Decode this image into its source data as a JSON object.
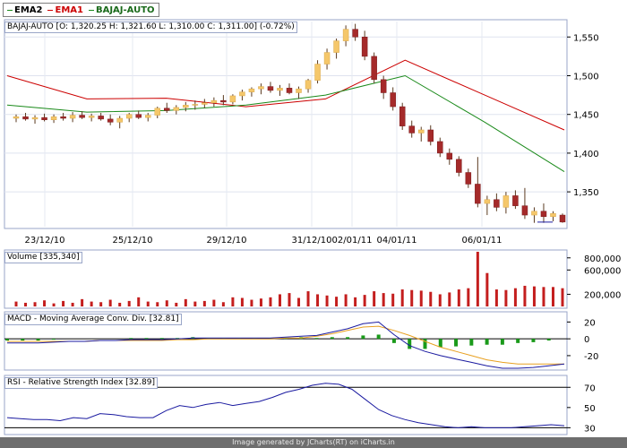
{
  "legend": [
    {
      "name": "EMA2",
      "color": "#1a8a1a"
    },
    {
      "name": "EMA1",
      "color": "#cc0000"
    },
    {
      "name": "BAJAJ-AUTO",
      "color": "#1a8a1a"
    }
  ],
  "price_label": "BAJAJ-AUTO [O: 1,320.25  H: 1,321.60  L: 1,310.00  C: 1,311.00] (-0.72%)",
  "volume_label": "Volume [335,340]",
  "macd_label": "MACD - Moving Average Conv. Div. [32.81]",
  "rsi_label": "RSI - Relative Strength Index [32.89]",
  "footer": "Image generated by JCharts(RT) on iCharts.in",
  "colors": {
    "up": "#f5c76a",
    "down": "#a52a2a",
    "ema1": "#cc0000",
    "ema2": "#1a8a1a",
    "volume": "#c41e1e",
    "macd": "#1a1aa0",
    "signal": "#e8a020",
    "hist_pos": "#1a9a1a",
    "hist_neg": "#1a9a1a",
    "rsi": "#1a1aa0"
  },
  "chart_data": [
    {
      "type": "candlestick",
      "title": "BAJAJ-AUTO",
      "x_tick_labels": [
        "23/12/10",
        "25/12/10",
        "29/12/10",
        "31/12/10",
        "02/01/11",
        "04/01/11",
        "06/01/11"
      ],
      "y_ticks": [
        1350,
        1400,
        1450,
        1500,
        1550
      ],
      "y_tick_labels": [
        "1,350",
        "1,400",
        "1,450",
        "1,500",
        "1,550"
      ],
      "ylim": [
        1305,
        1570
      ],
      "series": [
        {
          "name": "EMA1",
          "values": [
            1500,
            1470,
            1471,
            1460,
            1470,
            1520,
            1475,
            1430
          ]
        },
        {
          "name": "EMA2",
          "values": [
            1462,
            1453,
            1455,
            1462,
            1475,
            1500,
            1440,
            1376
          ]
        }
      ],
      "candles": [
        [
          1445,
          1450,
          1440,
          1447
        ],
        [
          1447,
          1452,
          1442,
          1444
        ],
        [
          1444,
          1449,
          1438,
          1446
        ],
        [
          1446,
          1451,
          1441,
          1443
        ],
        [
          1443,
          1450,
          1439,
          1447
        ],
        [
          1447,
          1452,
          1442,
          1445
        ],
        [
          1445,
          1453,
          1440,
          1449
        ],
        [
          1449,
          1454,
          1444,
          1446
        ],
        [
          1446,
          1451,
          1441,
          1448
        ],
        [
          1448,
          1452,
          1442,
          1444
        ],
        [
          1444,
          1450,
          1436,
          1440
        ],
        [
          1440,
          1448,
          1432,
          1445
        ],
        [
          1445,
          1452,
          1440,
          1450
        ],
        [
          1450,
          1455,
          1444,
          1446
        ],
        [
          1446,
          1452,
          1441,
          1449
        ],
        [
          1449,
          1460,
          1445,
          1458
        ],
        [
          1458,
          1465,
          1452,
          1455
        ],
        [
          1455,
          1462,
          1450,
          1459
        ],
        [
          1459,
          1466,
          1454,
          1462
        ],
        [
          1462,
          1468,
          1456,
          1463
        ],
        [
          1463,
          1470,
          1458,
          1465
        ],
        [
          1465,
          1472,
          1460,
          1468
        ],
        [
          1468,
          1475,
          1462,
          1466
        ],
        [
          1466,
          1476,
          1463,
          1474
        ],
        [
          1474,
          1482,
          1468,
          1479
        ],
        [
          1479,
          1485,
          1473,
          1483
        ],
        [
          1483,
          1490,
          1476,
          1486
        ],
        [
          1486,
          1492,
          1478,
          1481
        ],
        [
          1481,
          1488,
          1474,
          1484
        ],
        [
          1484,
          1490,
          1476,
          1478
        ],
        [
          1478,
          1486,
          1470,
          1483
        ],
        [
          1483,
          1496,
          1478,
          1494
        ],
        [
          1494,
          1520,
          1490,
          1515
        ],
        [
          1515,
          1535,
          1508,
          1530
        ],
        [
          1530,
          1548,
          1522,
          1545
        ],
        [
          1545,
          1565,
          1538,
          1560
        ],
        [
          1560,
          1567,
          1545,
          1550
        ],
        [
          1550,
          1558,
          1520,
          1525
        ],
        [
          1525,
          1530,
          1490,
          1495
        ],
        [
          1495,
          1500,
          1470,
          1478
        ],
        [
          1478,
          1485,
          1455,
          1460
        ],
        [
          1460,
          1465,
          1430,
          1435
        ],
        [
          1435,
          1442,
          1420,
          1426
        ],
        [
          1426,
          1434,
          1415,
          1430
        ],
        [
          1430,
          1436,
          1410,
          1415
        ],
        [
          1415,
          1420,
          1395,
          1400
        ],
        [
          1400,
          1406,
          1385,
          1392
        ],
        [
          1392,
          1396,
          1370,
          1375
        ],
        [
          1375,
          1380,
          1355,
          1360
        ],
        [
          1360,
          1395,
          1330,
          1335
        ],
        [
          1335,
          1345,
          1320,
          1340
        ],
        [
          1340,
          1348,
          1325,
          1330
        ],
        [
          1330,
          1350,
          1322,
          1345
        ],
        [
          1345,
          1352,
          1328,
          1332
        ],
        [
          1332,
          1355,
          1315,
          1320
        ],
        [
          1320,
          1330,
          1310,
          1325
        ],
        [
          1325,
          1335,
          1310,
          1318
        ],
        [
          1318,
          1325,
          1312,
          1322
        ],
        [
          1320,
          1322,
          1310,
          1311
        ]
      ]
    },
    {
      "type": "bar",
      "title": "Volume",
      "ylim": [
        0,
        900000
      ],
      "y_ticks": [
        200000,
        600000,
        800000
      ],
      "y_tick_labels": [
        "200,000",
        "600,000",
        "800,000"
      ],
      "values": [
        80000,
        60000,
        70000,
        100000,
        50000,
        90000,
        60000,
        120000,
        80000,
        70000,
        110000,
        60000,
        90000,
        150000,
        80000,
        70000,
        100000,
        60000,
        120000,
        80000,
        90000,
        110000,
        70000,
        150000,
        140000,
        110000,
        130000,
        150000,
        200000,
        220000,
        140000,
        250000,
        200000,
        180000,
        160000,
        200000,
        150000,
        190000,
        250000,
        220000,
        210000,
        280000,
        270000,
        260000,
        240000,
        200000,
        230000,
        280000,
        300000,
        900000,
        550000,
        280000,
        270000,
        300000,
        340000,
        330000,
        320000,
        320000,
        300000
      ]
    },
    {
      "type": "line",
      "title": "MACD - Moving Average Conv. Div.",
      "ylim": [
        -35,
        30
      ],
      "y_ticks": [
        20,
        0,
        -20
      ],
      "y_tick_labels": [
        "20",
        "0",
        "-20"
      ],
      "series": [
        {
          "name": "MACD",
          "values": [
            -5,
            -5,
            -5,
            -4,
            -3,
            -3,
            -2,
            -2,
            -1,
            -1,
            -1,
            0,
            1,
            1,
            1,
            1,
            1,
            1,
            2,
            3,
            4,
            8,
            12,
            18,
            20,
            5,
            -8,
            -15,
            -20,
            -24,
            -28,
            -32,
            -35,
            -35,
            -34,
            -32,
            -30
          ]
        },
        {
          "name": "Signal",
          "values": [
            -3,
            -3,
            -3,
            -3,
            -3,
            -3,
            -2,
            -2,
            -2,
            -2,
            -2,
            -1,
            -1,
            0,
            0,
            0,
            0,
            0,
            1,
            1,
            3,
            6,
            10,
            14,
            15,
            10,
            4,
            -3,
            -10,
            -15,
            -20,
            -25,
            -28,
            -30,
            -30,
            -30,
            -30
          ]
        },
        {
          "name": "Histogram",
          "values": [
            -2,
            -2,
            -2,
            -1,
            0,
            0,
            0,
            0,
            1,
            1,
            1,
            1,
            2,
            1,
            1,
            1,
            1,
            1,
            1,
            2,
            1,
            2,
            2,
            4,
            5,
            -5,
            -12,
            -12,
            -10,
            -9,
            -8,
            -7,
            -7,
            -5,
            -4,
            -2,
            0
          ]
        }
      ]
    },
    {
      "type": "line",
      "title": "RSI - Relative Strength Index",
      "ylim": [
        25,
        80
      ],
      "y_ticks": [
        70,
        50,
        30
      ],
      "y_tick_labels": [
        "70",
        "50",
        "30"
      ],
      "series": [
        {
          "name": "RSI",
          "values": [
            40,
            39,
            38,
            38,
            37,
            40,
            39,
            44,
            43,
            41,
            40,
            40,
            47,
            52,
            50,
            53,
            55,
            52,
            54,
            56,
            60,
            65,
            68,
            72,
            74,
            73,
            68,
            58,
            48,
            42,
            38,
            35,
            33,
            31,
            30,
            31,
            30,
            30,
            30,
            31,
            32,
            33,
            32
          ]
        }
      ]
    }
  ]
}
